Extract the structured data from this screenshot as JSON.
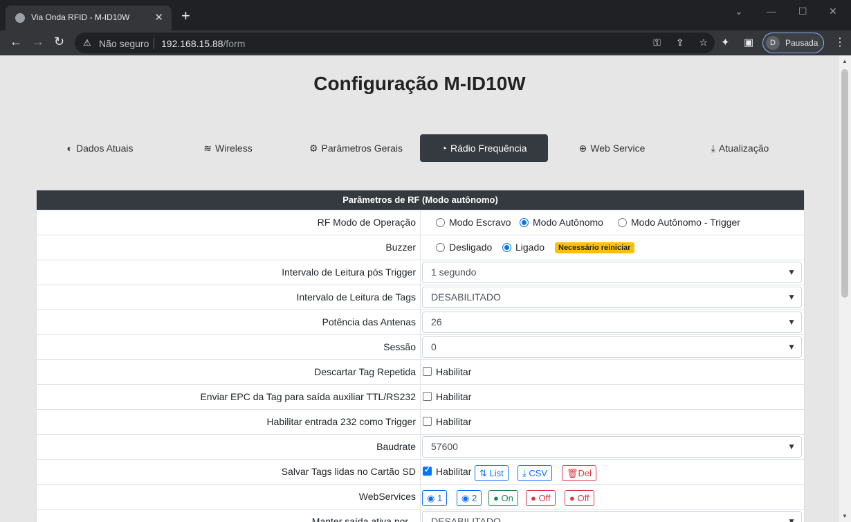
{
  "browser": {
    "tab_title": "Via Onda RFID - M-ID10W",
    "security_label": "Não seguro",
    "url_host": "192.168.15.88",
    "url_path": "/form",
    "profile_initial": "D",
    "profile_label": "Pausada"
  },
  "page": {
    "title": "Configuração M-ID10W"
  },
  "nav": [
    {
      "label": "Dados Atuais",
      "icon": "◐"
    },
    {
      "label": "Wireless",
      "icon": "≋"
    },
    {
      "label": "Parâmetros Gerais",
      "icon": "⚙"
    },
    {
      "label": "Rádio Frequência",
      "icon": "◔"
    },
    {
      "label": "Web Service",
      "icon": "⊕"
    },
    {
      "label": "Atualização",
      "icon": "⤓"
    }
  ],
  "nav_active": "Rádio Frequência",
  "table": {
    "header": "Parâmetros de RF (Modo autônomo)",
    "rows": {
      "rf_mode": {
        "label": "RF Modo de Operação",
        "options": [
          "Modo Escravo",
          "Modo Autônomo",
          "Modo Autônomo - Trigger"
        ],
        "selected": "Modo Autônomo"
      },
      "buzzer": {
        "label": "Buzzer",
        "options": [
          "Desligado",
          "Ligado"
        ],
        "selected": "Ligado",
        "badge": "Necessário reiniciar"
      },
      "trigger_interval": {
        "label": "Intervalo de Leitura pós Trigger",
        "value": "1 segundo"
      },
      "tag_interval": {
        "label": "Intervalo de Leitura de Tags",
        "value": "DESABILITADO"
      },
      "antenna_power": {
        "label": "Potência das Antenas",
        "value": "26"
      },
      "session": {
        "label": "Sessão",
        "value": "0"
      },
      "discard_repeated": {
        "label": "Descartar Tag Repetida",
        "check_label": "Habilitar",
        "checked": false
      },
      "send_epc": {
        "label": "Enviar EPC da Tag para saída auxiliar TTL/RS232",
        "check_label": "Habilitar",
        "checked": false
      },
      "enable_232": {
        "label": "Habilitar entrada 232 como Trigger",
        "check_label": "Habilitar",
        "checked": false
      },
      "baudrate": {
        "label": "Baudrate",
        "value": "57600"
      },
      "save_sd": {
        "label": "Salvar Tags lidas no Cartão SD",
        "check_label": "Habilitar",
        "checked": true,
        "buttons": [
          "List",
          "CSV",
          "Del"
        ]
      },
      "webservices": {
        "label": "WebServices",
        "buttons": [
          "1",
          "2",
          "On",
          "Off",
          "Off"
        ]
      },
      "keep_output": {
        "label": "Manter saída ativa por...",
        "value": "DESABILITADO"
      }
    }
  },
  "colors": {
    "dark": "#343a40",
    "accent": "#0d6efd",
    "danger": "#dc3545",
    "success": "#198754",
    "warning": "#ffc107"
  }
}
